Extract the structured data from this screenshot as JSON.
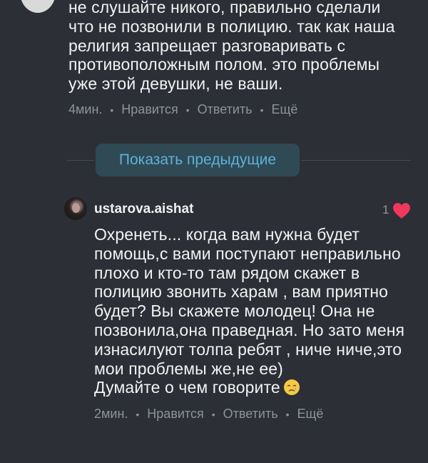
{
  "comments": [
    {
      "text": "не слушайте никого, правильно сделали\nчто не позвонили в полицию. так как наша\nрелигия запрещает разговаривать с\nпротивоположным полом. это проблемы\nуже этой девушки, не ваши.",
      "time": "4мин.",
      "like_label": "Нравится",
      "reply_label": "Ответить",
      "more_label": "Ещё"
    },
    {
      "username": "ustarova.aishat",
      "like_count": "1",
      "text": "Охренеть... когда вам нужна будет\nпомощь,с вами поступают неправильно\nплохо и кто-то там рядом скажет в\nполицию звонить харам , вам приятно\nбудет? Вы скажете молодец! Она не\nпозвонила,она праведная. Но зато меня\nизнасилуют толпа ребят , ниче ниче,это\nмои проблемы же,не ее)\nДумайте о чем говорите",
      "emoji": "crying-face",
      "time": "2мин.",
      "like_label": "Нравится",
      "reply_label": "Ответить",
      "more_label": "Ещё"
    }
  ],
  "show_previous_label": "Показать предыдущие",
  "colors": {
    "background": "#2c2f36",
    "text": "#f2f2f2",
    "meta": "#8c939d",
    "accent": "#5fb0d8",
    "heart": "#f0375d"
  }
}
